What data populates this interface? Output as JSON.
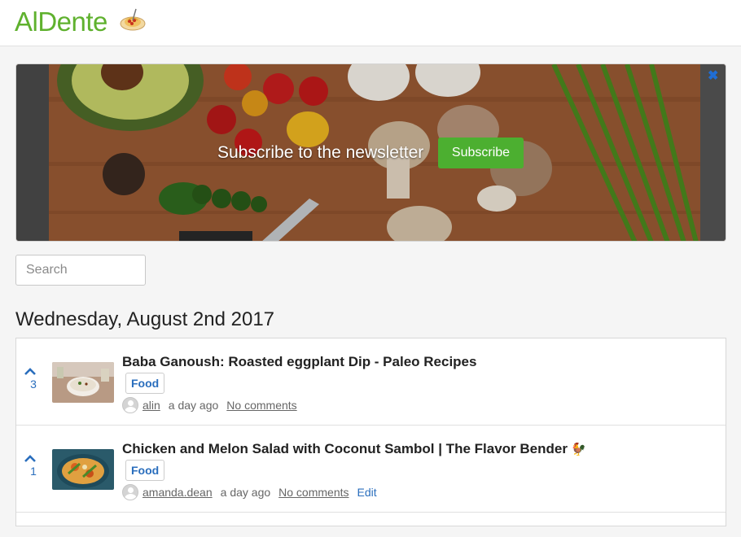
{
  "header": {
    "logo_text": "AlDente",
    "logo_icon": "spaghetti-plate-icon"
  },
  "banner": {
    "text": "Subscribe to the newsletter",
    "button_label": "Subscribe",
    "close_icon": "close-icon",
    "button_color": "#4caf30"
  },
  "search": {
    "placeholder": "Search",
    "value": ""
  },
  "date_heading": "Wednesday, August 2nd 2017",
  "posts": [
    {
      "votes": "3",
      "title": "Baba Ganoush: Roasted eggplant Dip - Paleo Recipes",
      "tag": "Food",
      "user": "alin",
      "time": "a day ago",
      "comments": "No comments"
    },
    {
      "votes": "1",
      "title": "Chicken and Melon Salad with Coconut Sambol | The Flavor Bender",
      "tag": "Food",
      "user": "amanda.dean",
      "time": "a day ago",
      "comments": "No comments",
      "edit": "Edit"
    }
  ],
  "colors": {
    "brand": "#5fb12e",
    "link": "#2a6ebd"
  }
}
